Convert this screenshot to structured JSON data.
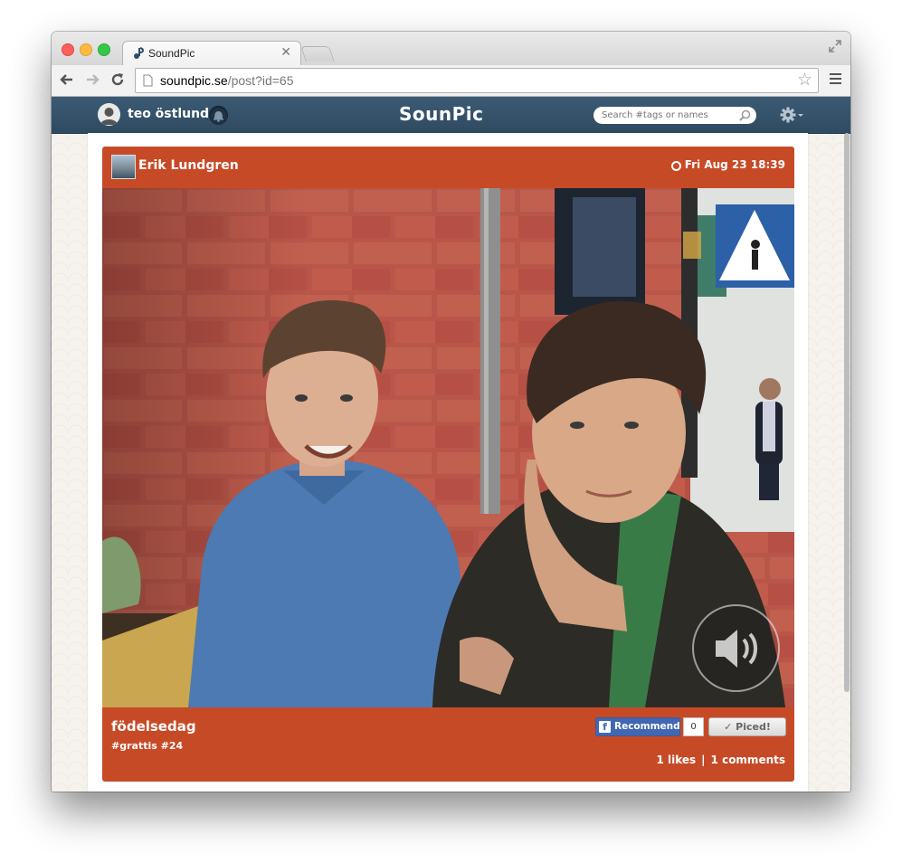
{
  "browser": {
    "tab_title": "SoundPic",
    "url_host": "soundpic.se",
    "url_path": "/post?id=65"
  },
  "app": {
    "logo": "SounPic",
    "user_name": "teo östlund",
    "search_placeholder": "Search #tags or names"
  },
  "post": {
    "author": "Erik Lundgren",
    "date": "Fri Aug 23 18:39",
    "title": "födelsedag",
    "tags": "#grattis #24",
    "fb_recommend_label": "Recommend",
    "fb_count": "0",
    "piced_label": "✓ Piced!",
    "likes": "1 likes",
    "stats_separator": "|",
    "comments": "1 comments"
  },
  "colors": {
    "post_accent": "#c74a27",
    "navbar": "#2f4b62",
    "facebook": "#4267b2"
  }
}
